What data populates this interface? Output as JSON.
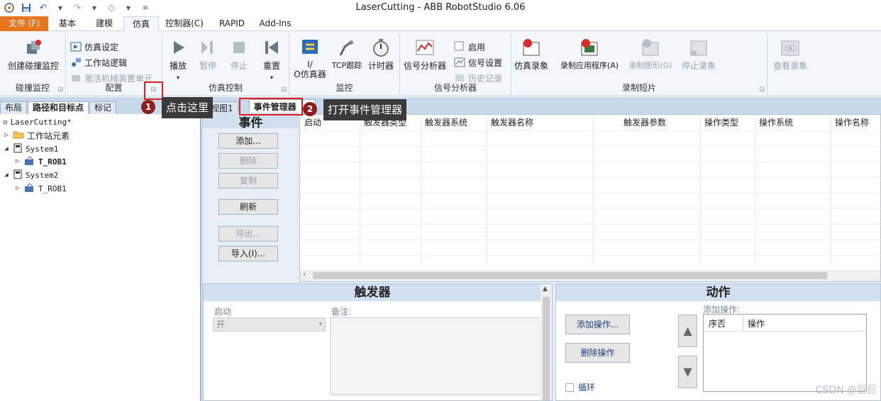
{
  "window": {
    "title": "LaserCutting - ABB RobotStudio 6.06"
  },
  "ribbon_tabs": [
    {
      "label": "文件 (F)"
    },
    {
      "label": "基本"
    },
    {
      "label": "建模"
    },
    {
      "label": "仿真"
    },
    {
      "label": "控制器(C)"
    },
    {
      "label": "RAPID"
    },
    {
      "label": "Add-Ins"
    }
  ],
  "ribbon": {
    "collision": {
      "label": "碰撞监控",
      "create_btn": "创建碰撞监控"
    },
    "config": {
      "label": "配置",
      "sim_setup": "仿真设定",
      "station_logic": "工作站逻辑",
      "activate_mech": "激活机械装置单元"
    },
    "sim_control": {
      "label": "仿真控制",
      "play": "播放",
      "pause": "暂停",
      "stop": "停止",
      "reset": "重置"
    },
    "monitor": {
      "label": "监控",
      "io_sim_1": "I/",
      "io_sim_2": "O仿真器",
      "tcp_trace": "TCP跟踪",
      "timer": "计时器"
    },
    "signal_analyzer": {
      "label": "信号分析器",
      "analyzer_btn": "信号分析器",
      "enable": "启用",
      "signal_setup": "信号设置",
      "history": "历史记录"
    },
    "recording": {
      "label": "录制短片",
      "sim_record": "仿真录象",
      "record_app": "录制应用程序(A)",
      "record_graphics": "录制图形(G)",
      "stop_record": "停止录象",
      "view_record": "查看录象"
    }
  },
  "left_panel": {
    "tabs": [
      "布局",
      "路径和目标点",
      "标记"
    ],
    "tree": {
      "root": "LaserCutting*",
      "station_elements": "工作站元素",
      "system1": "System1",
      "rob1_a": "T_ROB1",
      "system2": "System2",
      "rob1_b": "T_ROB1"
    }
  },
  "doc_tabs": {
    "view1": "视图1",
    "event_manager": "事件管理器",
    "close": "✕"
  },
  "event_manager": {
    "events_title": "事件",
    "buttons": {
      "add": "添加...",
      "delete": "删除",
      "copy": "复制",
      "refresh": "刷新",
      "export": "导出...",
      "import": "导入(I)..."
    },
    "columns": [
      "启动",
      "触发器类型",
      "触发器系统",
      "触发器名称",
      "触发器参数",
      "操作类型",
      "操作系统",
      "操作名称"
    ],
    "trigger": {
      "title": "触发器",
      "start_label": "启动",
      "start_value": "开",
      "note_label": "备注:"
    },
    "action": {
      "title": "动作",
      "add_action_label": "添加操作:",
      "add_action_btn": "添加操作...",
      "delete_action_btn": "删除操作",
      "loop": "循环",
      "col_seq": "序否",
      "col_action": "操作"
    }
  },
  "annotations": {
    "step1_num": "1",
    "step1_text": "点击这里",
    "step2_num": "2",
    "step2_text": "打开事件管理器"
  },
  "watermark": "CSDN @巨巨",
  "colors": {
    "accent_orange": "#e8761e",
    "annotation_red": "#e02020",
    "badge_dark_red": "#8b1f1f"
  }
}
